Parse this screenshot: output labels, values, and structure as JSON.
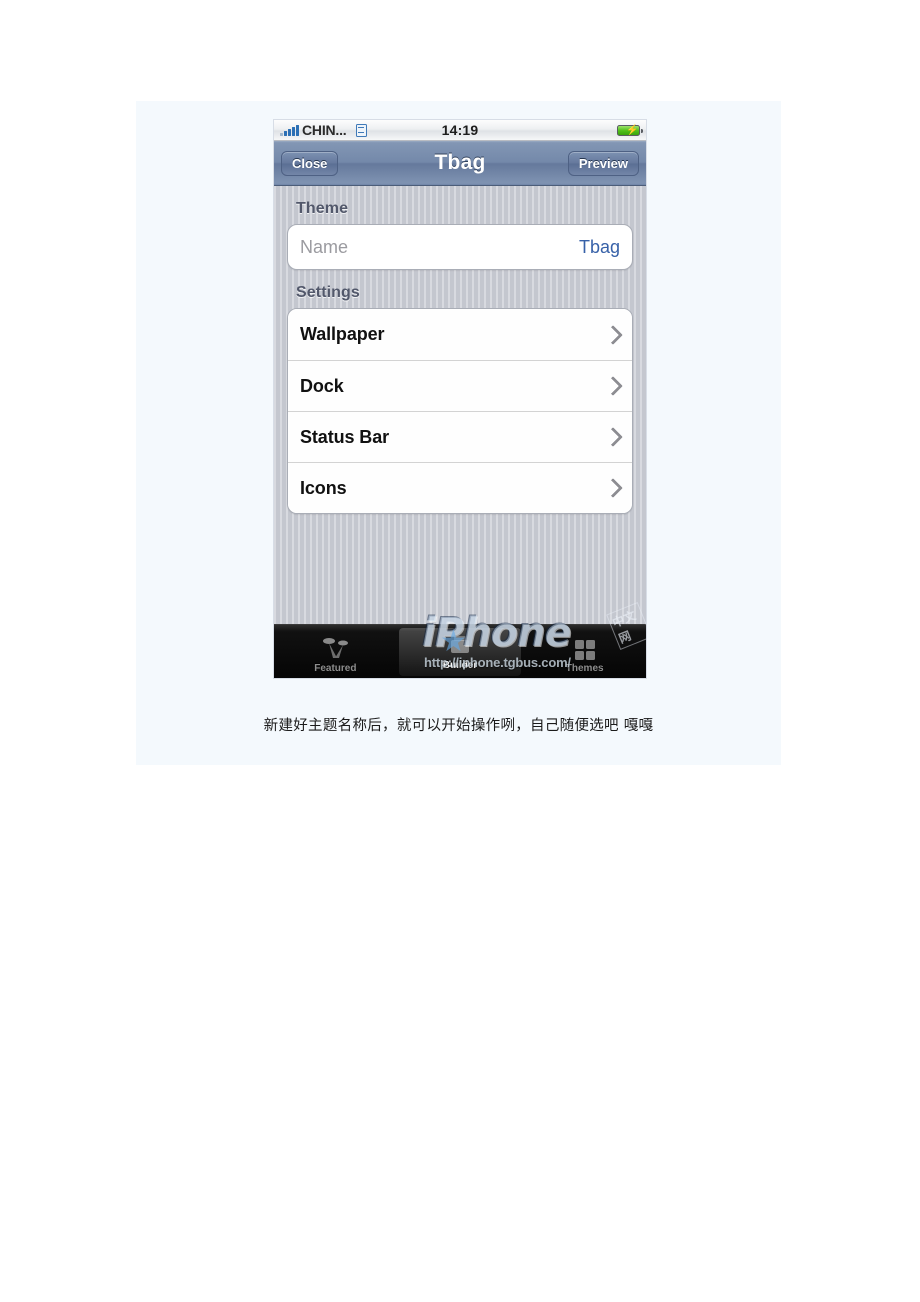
{
  "document": {
    "caption": "新建好主题名称后，就可以开始操作咧，自己随便选吧  嘎嘎",
    "background_color": "#f4f9fd"
  },
  "phone": {
    "status_bar": {
      "signal_icon": "signal-bars-icon",
      "carrier": "CHIN...",
      "network_badge": "E",
      "time": "14:19",
      "battery_icon": "battery-charging-icon",
      "battery_bolt": "⚡"
    },
    "nav_bar": {
      "left_button": "Close",
      "title": "Tbag",
      "right_button": "Preview",
      "accent_color": "#6f84a6"
    },
    "sections": [
      {
        "header": "Theme",
        "rows": [
          {
            "type": "field",
            "label": "Name",
            "value": "Tbag",
            "value_color": "#3761a8"
          }
        ]
      },
      {
        "header": "Settings",
        "rows": [
          {
            "type": "nav",
            "label": "Wallpaper",
            "accessory": "chevron-right-icon"
          },
          {
            "type": "nav",
            "label": "Dock",
            "accessory": "chevron-right-icon"
          },
          {
            "type": "nav",
            "label": "Status Bar",
            "accessory": "chevron-right-icon"
          },
          {
            "type": "nav",
            "label": "Icons",
            "accessory": "chevron-right-icon"
          }
        ]
      }
    ],
    "tab_bar": {
      "tabs": [
        {
          "label": "Featured",
          "icon": "spotlight-icon",
          "selected": false
        },
        {
          "label": "Builder",
          "icon": "builder-icon",
          "selected": true
        },
        {
          "label": "Themes",
          "icon": "themes-icon",
          "selected": false
        }
      ]
    },
    "watermark": {
      "brand": "iPhone",
      "apple_glyph": "",
      "url": "http://iphone.tgbus.com/",
      "cn_text": "中文网",
      "star_glyph": "★"
    }
  }
}
